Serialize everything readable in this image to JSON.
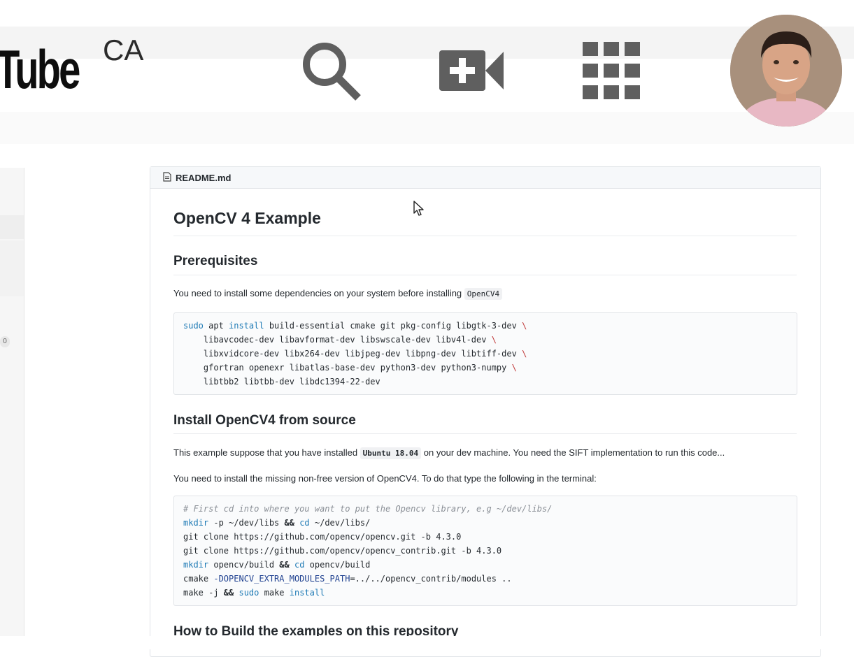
{
  "youtube": {
    "logo_text": "Tube",
    "region": "CA"
  },
  "sidebar": {
    "count_badge": "0"
  },
  "readme": {
    "filename": "README.md",
    "title": "OpenCV 4 Example",
    "prereq_heading": "Prerequisites",
    "prereq_text": "You need to install some dependencies on your system before installing",
    "prereq_code": "OpenCV4",
    "install_heading": "Install OpenCV4 from source",
    "install_text_1_before": "This example suppose that you have installed",
    "install_text_1_code": "Ubuntu 18.04",
    "install_text_1_after": "on your dev machine. You need the SIFT implementation to run this code...",
    "install_text_2": "You need to install the missing non-free version of OpenCV4. To do that type the following in the terminal:",
    "build_heading": "How to Build the examples on this repository"
  },
  "code1": {
    "l1_cmd1": "sudo",
    "l1_mid": " apt ",
    "l1_cmd2": "install",
    "l1_rest": " build-essential cmake git pkg-config libgtk-3-dev ",
    "l2": "    libavcodec-dev libavformat-dev libswscale-dev libv4l-dev ",
    "l3": "    libxvidcore-dev libx264-dev libjpeg-dev libpng-dev libtiff-dev ",
    "l4": "    gfortran openexr libatlas-base-dev python3-dev python3-numpy ",
    "l5": "    libtbb2 libtbb-dev libdc1394-22-dev",
    "esc": "\\"
  },
  "code2": {
    "comment": "# First cd into where you want to put the Opencv library, e.g ~/dev/libs/",
    "mkdir": "mkdir",
    "l2_a": " -p ~/dev/libs ",
    "and": "&&",
    "cd": "cd",
    "l2_b": " ~/dev/libs/",
    "l3": "git clone https://github.com/opencv/opencv.git -b 4.3.0",
    "l4": "git clone https://github.com/opencv/opencv_contrib.git -b 4.3.0",
    "l5_a": " opencv/build ",
    "l5_b": " opencv/build",
    "l6_a": "cmake ",
    "l6_opt": "-DOPENCV_EXTRA_MODULES_PATH",
    "l6_b": "=../../opencv_contrib/modules ..",
    "l7_a": "make -j ",
    "sudo": "sudo",
    "l7_b": " make ",
    "install": "install"
  }
}
